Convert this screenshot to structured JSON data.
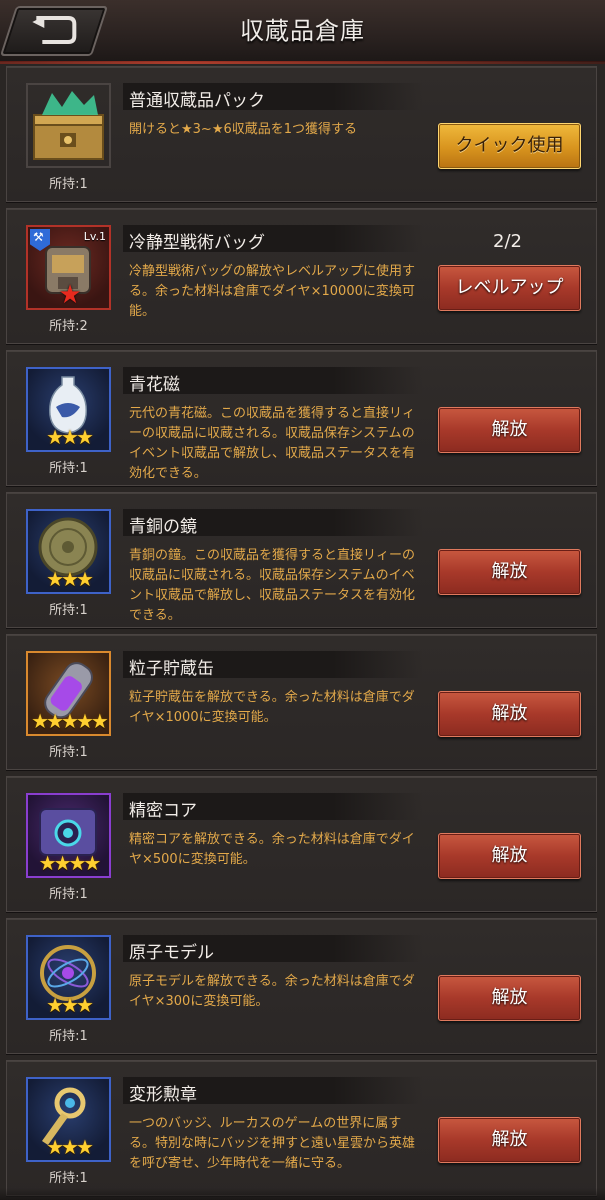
{
  "header": {
    "title": "収蔵品倉庫",
    "back_icon": "back-arrow-icon"
  },
  "items": [
    {
      "name": "普通収蔵品パック",
      "desc": "開けると★3~★6収蔵品を1つ獲得する",
      "owned": "所持:1",
      "button": "クイック使用",
      "button_style": "gold",
      "frame": "gold",
      "stars": 0,
      "icon": "chest-icon"
    },
    {
      "name": "冷静型戦術バッグ",
      "desc": "冷静型戦術バッグの解放やレベルアップに使用する。余った材料は倉庫でダイヤ×10000に変換可能。",
      "owned": "所持:2",
      "button": "レベルアップ",
      "button_style": "red",
      "frame": "red",
      "count": "2/2",
      "level": "Lv.1",
      "stars": 0,
      "icon": "tactical-bag-icon"
    },
    {
      "name": "青花磁",
      "desc": "元代の青花磁。この収蔵品を獲得すると直接リィーの収蔵品に収蔵される。収蔵品保存システムのイベント収蔵品で解放し、収蔵品ステータスを有効化できる。",
      "owned": "所持:1",
      "button": "解放",
      "button_style": "red",
      "frame": "blue",
      "stars": 3,
      "icon": "porcelain-vase-icon"
    },
    {
      "name": "青銅の鏡",
      "desc": "青銅の鐘。この収蔵品を獲得すると直接リィーの収蔵品に収蔵される。収蔵品保存システムのイベント収蔵品で解放し、収蔵品ステータスを有効化できる。",
      "owned": "所持:1",
      "button": "解放",
      "button_style": "red",
      "frame": "blue",
      "stars": 3,
      "icon": "bronze-mirror-icon"
    },
    {
      "name": "粒子貯蔵缶",
      "desc": "粒子貯蔵缶を解放できる。余った材料は倉庫でダイヤ×1000に変換可能。",
      "owned": "所持:1",
      "button": "解放",
      "button_style": "red",
      "frame": "orange",
      "stars": 5,
      "icon": "particle-canister-icon"
    },
    {
      "name": "精密コア",
      "desc": "精密コアを解放できる。余った材料は倉庫でダイヤ×500に変換可能。",
      "owned": "所持:1",
      "button": "解放",
      "button_style": "red",
      "frame": "purple",
      "stars": 4,
      "icon": "precision-core-icon"
    },
    {
      "name": "原子モデル",
      "desc": "原子モデルを解放できる。余った材料は倉庫でダイヤ×300に変換可能。",
      "owned": "所持:1",
      "button": "解放",
      "button_style": "red",
      "frame": "blue",
      "stars": 3,
      "icon": "atom-model-icon"
    },
    {
      "name": "変形勲章",
      "desc": "一つのバッジ、ルーカスのゲームの世界に属する。特別な時にバッジを押すと遠い星雲から英雄を呼び寄せ、少年時代を一緒に守る。",
      "owned": "所持:1",
      "button": "解放",
      "button_style": "red",
      "frame": "blue",
      "stars": 3,
      "icon": "transform-medal-icon"
    }
  ],
  "colors": {
    "background": "#2a2624",
    "desc_text": "#e3a94a",
    "star": "#ffcf30"
  }
}
